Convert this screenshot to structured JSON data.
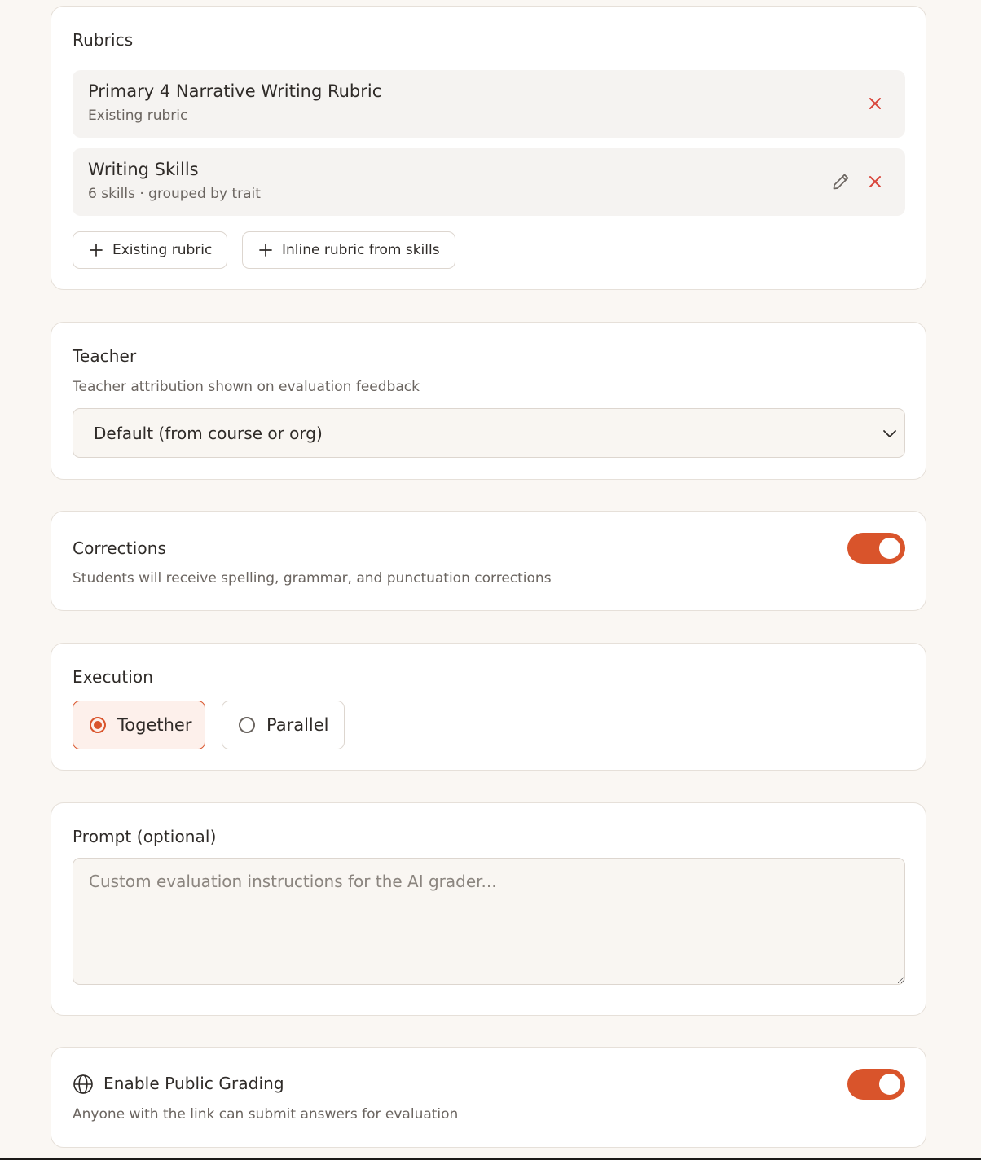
{
  "rubrics": {
    "title": "Rubrics",
    "items": [
      {
        "name": "Primary 4 Narrative Writing Rubric",
        "subtitle": "Existing rubric"
      },
      {
        "name": "Writing Skills",
        "subtitle": "6 skills · grouped by trait"
      }
    ],
    "add_existing_label": "Existing rubric",
    "add_inline_label": "Inline rubric from skills"
  },
  "teacher": {
    "title": "Teacher",
    "description": "Teacher attribution shown on evaluation feedback",
    "selected_value": "Default (from course or org)"
  },
  "corrections": {
    "title": "Corrections",
    "description": "Students will receive spelling, grammar, and punctuation corrections",
    "enabled": true
  },
  "execution": {
    "title": "Execution",
    "options": [
      {
        "label": "Together",
        "selected": true
      },
      {
        "label": "Parallel",
        "selected": false
      }
    ]
  },
  "prompt": {
    "title": "Prompt (optional)",
    "placeholder": "Custom evaluation instructions for the AI grader...",
    "value": ""
  },
  "public_grading": {
    "title": "Enable Public Grading",
    "description": "Anyone with the link can submit answers for evaluation",
    "enabled": true,
    "icon": "globe-icon"
  },
  "colors": {
    "accent": "#d9542b",
    "remove": "#d9453a",
    "background": "#faf7f3"
  }
}
